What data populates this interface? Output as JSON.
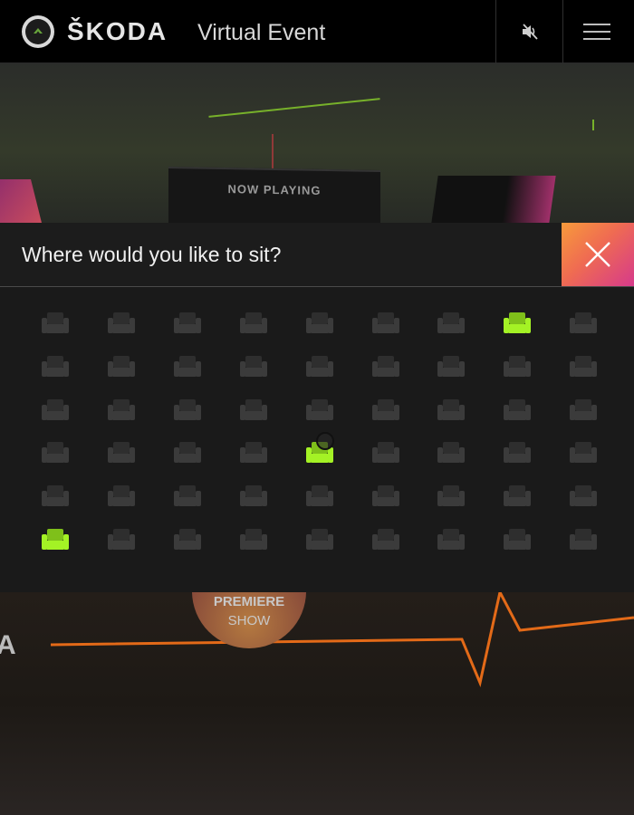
{
  "header": {
    "brand": "ŠKODA",
    "subtitle": "Virtual Event",
    "logo_icon": "skoda-arrow-logo-icon",
    "mute_icon": "speaker-muted-icon",
    "menu_icon": "hamburger-menu-icon"
  },
  "background": {
    "now_playing": "NOW PLAYING",
    "premiere_line1": "PREMIERE",
    "premiere_line2": "SHOW",
    "side_letter": "A"
  },
  "modal": {
    "title": "Where would you like to sit?",
    "close_icon": "close-x-icon"
  },
  "seats": {
    "rows": 6,
    "cols": 9,
    "occupied_color": "#1f1f1f",
    "available_color": "#3b3b3b",
    "selected_color": "#a4f225",
    "highlighted": [
      {
        "row": 1,
        "col": 8
      },
      {
        "row": 4,
        "col": 5
      },
      {
        "row": 6,
        "col": 1
      }
    ]
  },
  "colors": {
    "header_bg": "#000000",
    "modal_bg": "#1a1a1a",
    "accent_gradient_start": "#f79a3b",
    "accent_gradient_end": "#d63a8b",
    "seat_highlight": "#a4f225"
  }
}
